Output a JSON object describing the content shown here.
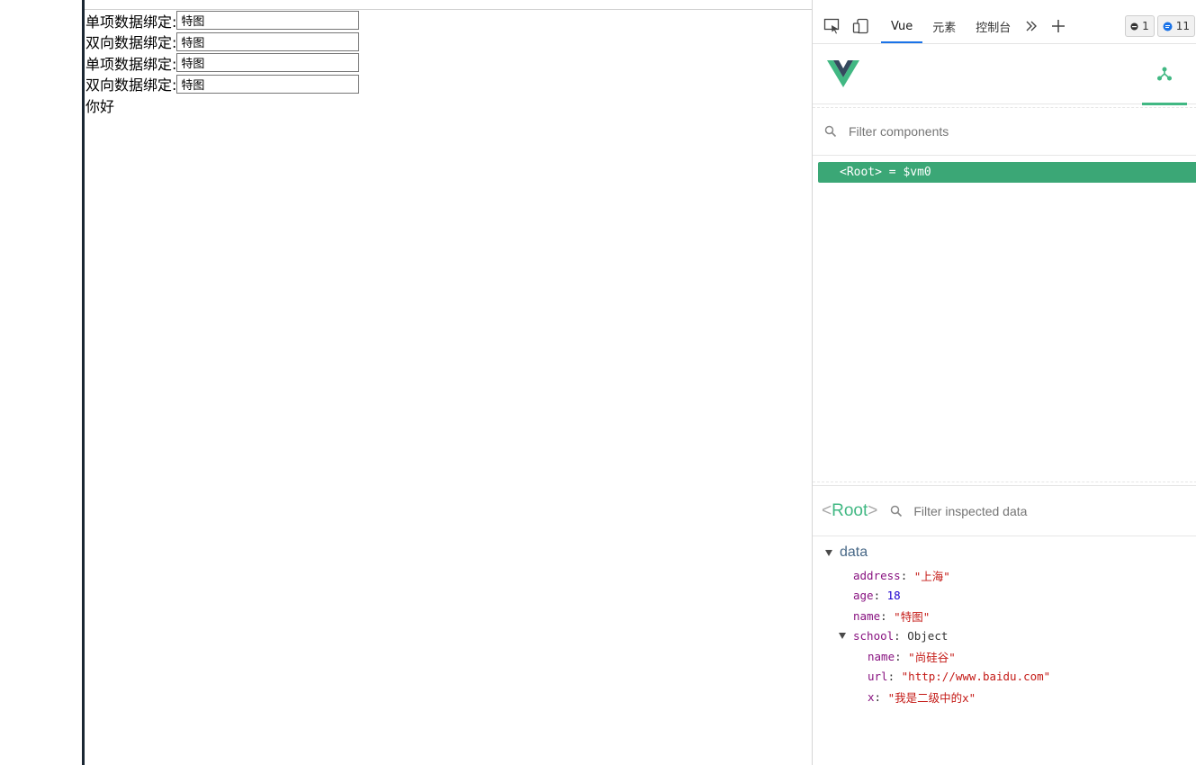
{
  "page": {
    "rows": [
      {
        "label": "单项数据绑定:",
        "value": "特图"
      },
      {
        "label": "双向数据绑定:",
        "value": "特图"
      },
      {
        "label": "单项数据绑定:",
        "value": "特图"
      },
      {
        "label": "双向数据绑定:",
        "value": "特图"
      }
    ],
    "hello": "你好"
  },
  "devtools": {
    "tabs": [
      {
        "label": "Vue",
        "active": true
      },
      {
        "label": "元素",
        "active": false
      },
      {
        "label": "控制台",
        "active": false
      }
    ],
    "badges": {
      "errors": "1",
      "messages": "11"
    },
    "filter_components_placeholder": "Filter components",
    "root_row": "<Root> = $vm0",
    "inspector": {
      "root_tag": "Root",
      "filter_placeholder": "Filter inspected data",
      "section": "data",
      "props": {
        "address_key": "address",
        "address_val": "\"上海\"",
        "age_key": "age",
        "age_val": "18",
        "name_key": "name",
        "name_val": "\"特图\"",
        "school_key": "school",
        "school_val": "Object",
        "school_name_key": "name",
        "school_name_val": "\"尚硅谷\"",
        "school_url_key": "url",
        "school_url_val": "\"http://www.baidu.com\"",
        "school_x_key": "x",
        "school_x_val": "\"我是二级中的x\""
      }
    },
    "colors": {
      "vue_green": "#41b883",
      "root_row_bg": "#3ba776",
      "key": "#881280",
      "string": "#c41a16",
      "number": "#1c00cf"
    }
  }
}
